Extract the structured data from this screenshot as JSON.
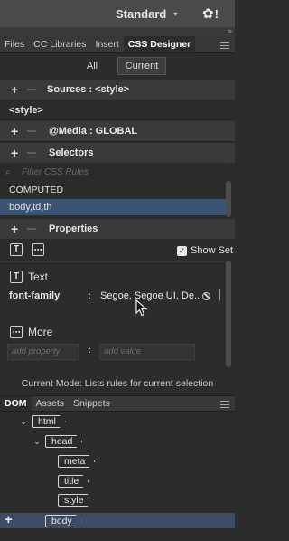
{
  "topbar": {
    "workspace_label": "Standard",
    "workspace_caret": "▾",
    "settings_bang": "!",
    "collapse_glyph": "»"
  },
  "tabs": [
    {
      "label": "Files"
    },
    {
      "label": "CC Libraries"
    },
    {
      "label": "Insert"
    },
    {
      "label": "CSS Designer"
    }
  ],
  "view_toggle": {
    "all": "All",
    "current": "Current"
  },
  "sources": {
    "add": "+",
    "label": "Sources : <style>",
    "item": "<style>"
  },
  "media": {
    "add": "+",
    "label": "@Media : GLOBAL"
  },
  "selectors": {
    "add": "+",
    "label": "Selectors",
    "filter_placeholder": "Filter CSS Rules",
    "items": [
      {
        "label": "COMPUTED"
      },
      {
        "label": "body,td,th"
      }
    ]
  },
  "properties": {
    "add": "+",
    "label": "Properties",
    "show_set_label": "Show Set",
    "text_icon": "T",
    "more_icon": "⋯",
    "text_section": "Text",
    "font_family_label": "font-family",
    "font_family_colon": ":",
    "font_family_value": "Segoe, Segoe UI, De...",
    "more_section": "More",
    "add_property_placeholder": "add property",
    "add_value_placeholder": "add value",
    "colon": ":"
  },
  "status": "Current Mode: Lists rules for current selection",
  "dom_tabs": [
    {
      "label": "DOM"
    },
    {
      "label": "Assets"
    },
    {
      "label": "Snippets"
    }
  ],
  "dom_tree": {
    "html": "html",
    "head": "head",
    "meta": "meta",
    "title": "title",
    "style": "style",
    "body": "body",
    "expanded": "⌄",
    "add_glyph": "+"
  },
  "colors": {
    "panel_bg": "#2c2c2c",
    "selection": "#3c5474",
    "dom_selection": "#3b4c63"
  }
}
